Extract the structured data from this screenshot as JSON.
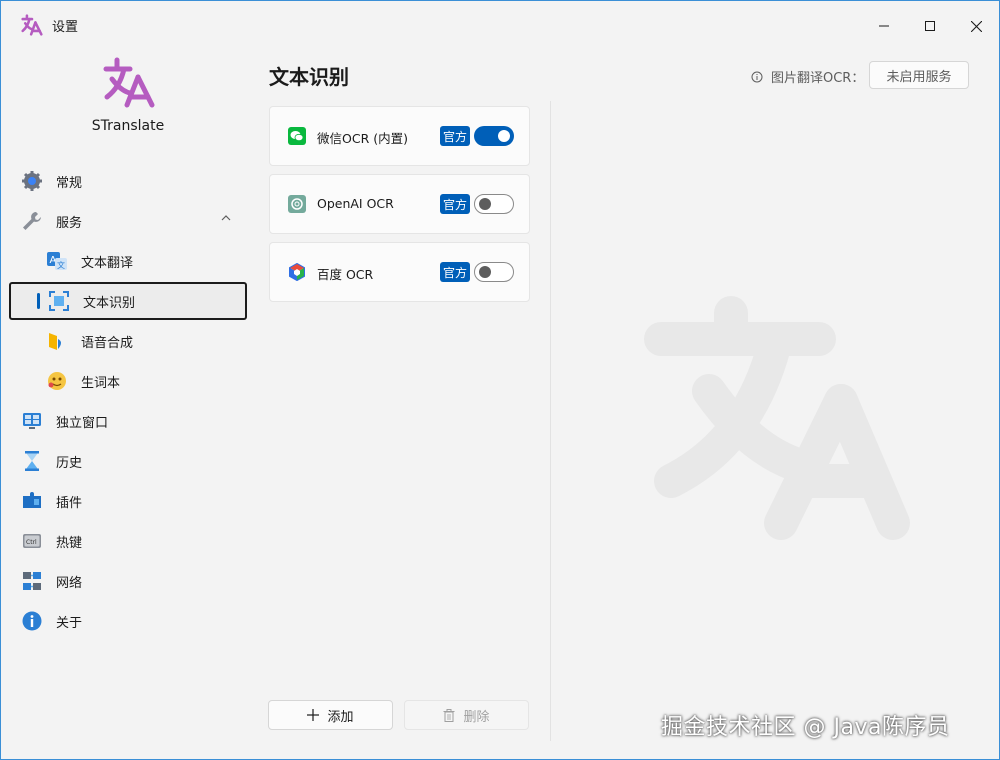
{
  "window": {
    "title": "设置",
    "controls": {
      "minimize": "minimize-icon",
      "maximize": "maximize-icon",
      "close": "close-icon"
    }
  },
  "sidebar": {
    "app_name": "STranslate",
    "items": [
      {
        "label": "常规",
        "icon": "gear-icon"
      },
      {
        "label": "服务",
        "icon": "wrench-icon",
        "expanded": true
      },
      {
        "label": "文本翻译",
        "icon": "translate-icon"
      },
      {
        "label": "文本识别",
        "icon": "ocr-scan-icon",
        "selected": true
      },
      {
        "label": "语音合成",
        "icon": "speech-icon"
      },
      {
        "label": "生词本",
        "icon": "vocabulary-icon"
      },
      {
        "label": "独立窗口",
        "icon": "window-icon"
      },
      {
        "label": "历史",
        "icon": "hourglass-icon"
      },
      {
        "label": "插件",
        "icon": "plugin-icon"
      },
      {
        "label": "热键",
        "icon": "keyboard-icon"
      },
      {
        "label": "网络",
        "icon": "network-icon"
      },
      {
        "label": "关于",
        "icon": "info-icon"
      }
    ]
  },
  "main": {
    "title": "文本识别",
    "image_translate_label": "图片翻译OCR：",
    "image_translate_status": "未启用服务",
    "services": [
      {
        "name": "微信OCR (内置)",
        "badge": "官方",
        "enabled": true,
        "icon": "wechat-icon",
        "color": "#09b83e"
      },
      {
        "name": "OpenAI OCR",
        "badge": "官方",
        "enabled": false,
        "icon": "openai-icon",
        "color": "#74aa9c"
      },
      {
        "name": "百度 OCR",
        "badge": "官方",
        "enabled": false,
        "icon": "baidu-icon",
        "color": "#2932e1"
      }
    ],
    "add_label": "添加",
    "delete_label": "删除"
  },
  "watermark": "掘金技术社区 @ Java陈序员",
  "colors": {
    "accent": "#005fb8",
    "logo": "#b55cc0",
    "window_border": "#3a8fd6"
  }
}
